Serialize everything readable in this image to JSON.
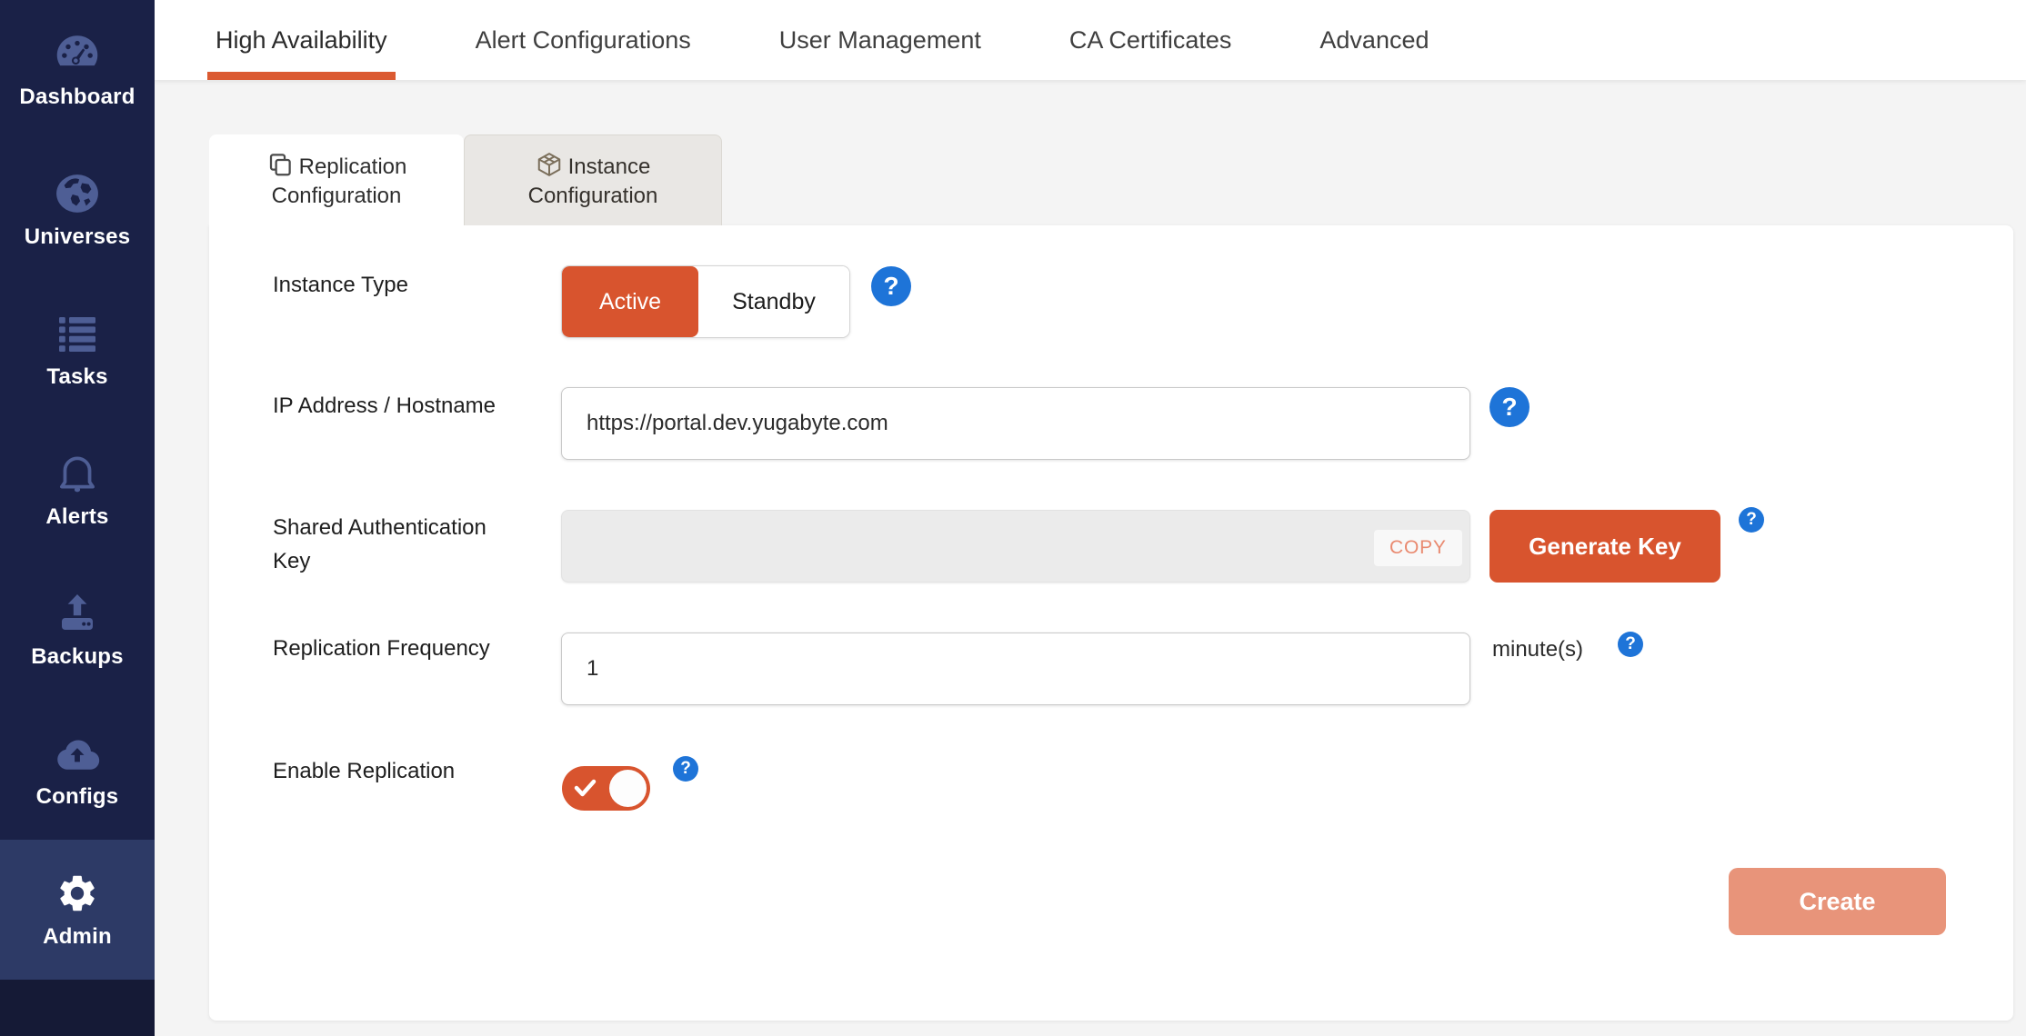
{
  "sidebar": {
    "items": [
      {
        "label": "Dashboard",
        "icon": "dashboard-gauge-icon",
        "active": false
      },
      {
        "label": "Universes",
        "icon": "globe-icon",
        "active": false
      },
      {
        "label": "Tasks",
        "icon": "task-list-icon",
        "active": false
      },
      {
        "label": "Alerts",
        "icon": "bell-icon",
        "active": false
      },
      {
        "label": "Backups",
        "icon": "upload-icon",
        "active": false
      },
      {
        "label": "Configs",
        "icon": "cloud-upload-icon",
        "active": false
      },
      {
        "label": "Admin",
        "icon": "gear-icon",
        "active": true
      }
    ]
  },
  "top_tabs": {
    "items": [
      {
        "label": "High Availability",
        "active": true
      },
      {
        "label": "Alert Configurations",
        "active": false
      },
      {
        "label": "User Management",
        "active": false
      },
      {
        "label": "CA Certificates",
        "active": false
      },
      {
        "label": "Advanced",
        "active": false
      }
    ]
  },
  "sub_tabs": {
    "items": [
      {
        "label": "Replication Configuration",
        "icon": "copy-pages-icon",
        "active": true
      },
      {
        "label": "Instance Configuration",
        "icon": "cube-icon",
        "active": false
      }
    ]
  },
  "form": {
    "instance_type": {
      "label": "Instance Type",
      "options": [
        "Active",
        "Standby"
      ],
      "selected": "Active"
    },
    "ip_address": {
      "label": "IP Address / Hostname",
      "value": "https://portal.dev.yugabyte.com"
    },
    "shared_key": {
      "label": "Shared Authentication Key",
      "value": "",
      "copy_label": "COPY",
      "generate_label": "Generate Key"
    },
    "replication_frequency": {
      "label": "Replication Frequency",
      "value": "1",
      "unit": "minute(s)"
    },
    "enable_replication": {
      "label": "Enable Replication",
      "enabled": true
    },
    "create_label": "Create"
  },
  "icons": {
    "help_glyph": "?"
  },
  "colors": {
    "accent_orange": "#D8542E",
    "tab_underline": "#DB5A31",
    "create_disabled": "#E8947A",
    "copy_text": "#E98A70",
    "help_blue": "#1E74D8",
    "sidebar_bg": "#1A2147",
    "sidebar_active_bg": "#2D3A66",
    "sidebar_icon": "#4E5E95",
    "content_bg": "#F4F4F4"
  }
}
